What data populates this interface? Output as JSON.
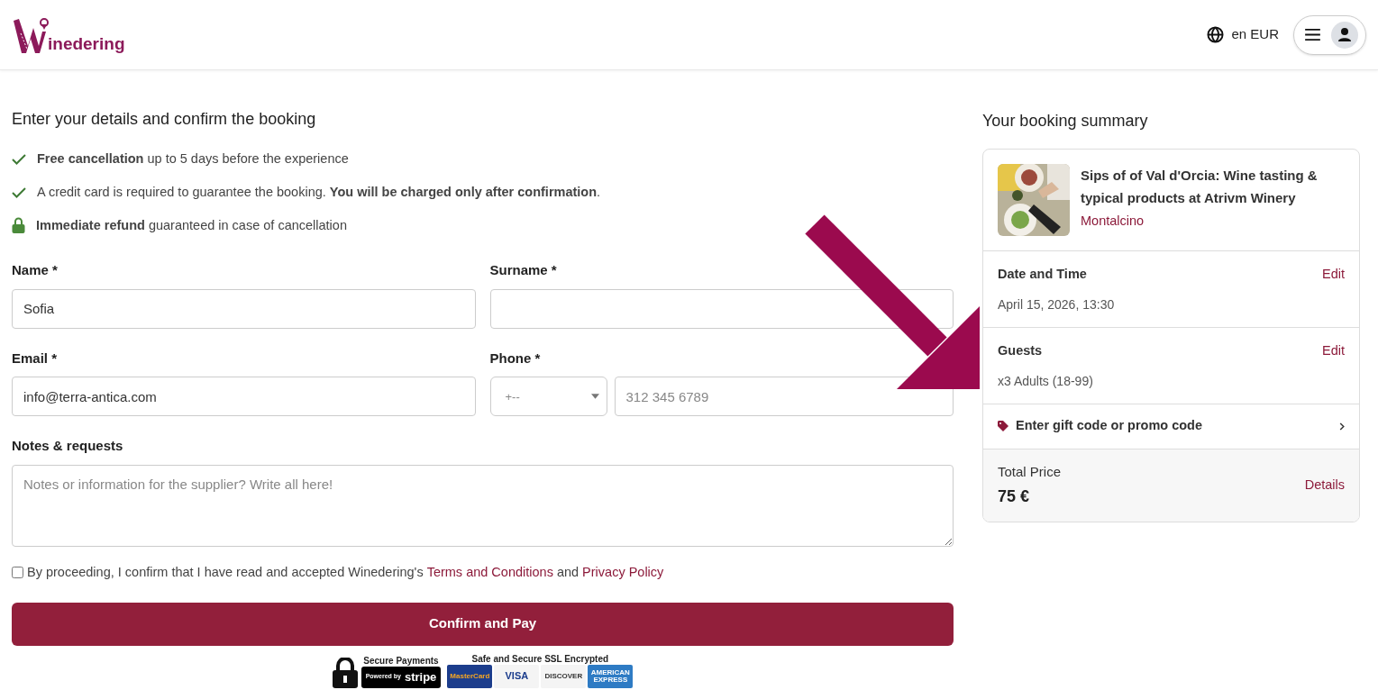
{
  "header": {
    "logo_text": "inedering",
    "locale": "en EUR"
  },
  "form": {
    "title": "Enter your details and confirm the booking",
    "benefits": [
      {
        "kind": "check",
        "text": "**Free cancellation** up to 5 days before the experience"
      },
      {
        "kind": "check",
        "text": "A credit card is required to guarantee the booking. **You will be charged only after confirmation**."
      },
      {
        "kind": "lock",
        "text": "**Immediate refund** guaranteed in case of cancellation"
      }
    ],
    "name": {
      "label": "Name *",
      "value": "Sofia"
    },
    "surname": {
      "label": "Surname *"
    },
    "email": {
      "label": "Email *",
      "value": "info@terra-antica.com"
    },
    "phone": {
      "label": "Phone *",
      "prefix": "+--",
      "placeholder": "312 345 6789"
    },
    "notes": {
      "label": "Notes & requests",
      "placeholder": "Notes or information for the supplier? Write all here!"
    },
    "consent": {
      "checked": false,
      "text": "By proceeding, I confirm that I have read and accepted Winedering's",
      "terms": "Terms and Conditions",
      "and": "and",
      "privacy": "Privacy Policy"
    },
    "submit": "Confirm and Pay",
    "badges": {
      "secure": "Secure Payments",
      "powered": "Powered by",
      "stripe": "stripe",
      "ssl": "Safe and Secure SSL Encrypted",
      "cards": [
        "MasterCard",
        "VISA",
        "DISCOVER",
        "AMERICAN EXPRESS"
      ]
    }
  },
  "summary": {
    "title": "Your booking summary",
    "product": {
      "kind": "picture",
      "name": "Sips of of Val d'Orcia: Wine tasting & typical products at Atrivm Winery",
      "location": "Montalcino"
    },
    "sections": [
      {
        "label": "Date and Time",
        "action": "Edit",
        "value": "April 15, 2026, 13:30"
      },
      {
        "label": "Guests",
        "action": "Edit",
        "value": "x3 Adults (18-99)"
      }
    ],
    "promo": "Enter gift code or promo code",
    "total": {
      "label": "Total Price",
      "price": "75 €",
      "action": "Details"
    }
  }
}
